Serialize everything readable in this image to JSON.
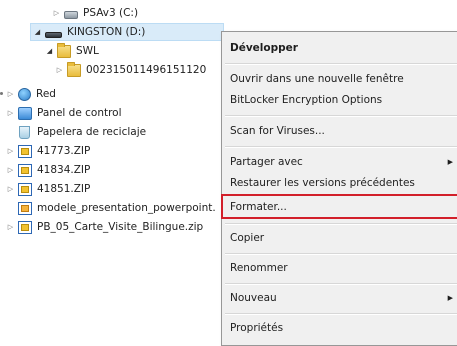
{
  "tree": {
    "items": [
      {
        "label": "PSAv3 (C:)",
        "icon": "drive-icon"
      },
      {
        "label": "KINGSTON (D:)",
        "icon": "usb-drive-icon"
      },
      {
        "label": "SWL",
        "icon": "folder-icon"
      },
      {
        "label": "002315011496151120",
        "icon": "folder-icon"
      },
      {
        "label": "Red",
        "icon": "network-icon"
      },
      {
        "label": "Panel de control",
        "icon": "control-panel-icon"
      },
      {
        "label": "Papelera de reciclaje",
        "icon": "recycle-bin-icon"
      },
      {
        "label": "41773.ZIP",
        "icon": "zip-icon"
      },
      {
        "label": "41834.ZIP",
        "icon": "zip-icon"
      },
      {
        "label": "41851.ZIP",
        "icon": "zip-icon"
      },
      {
        "label": "modele_presentation_powerpoint.",
        "icon": "pptx-icon"
      },
      {
        "label": "PB_05_Carte_Visite_Bilingue.zip",
        "icon": "zip-icon"
      }
    ]
  },
  "context_menu": {
    "items": [
      {
        "label": "Développer",
        "bold": true
      },
      {
        "label": "Ouvrir dans une nouvelle fenêtre"
      },
      {
        "label": "BitLocker Encryption Options"
      },
      {
        "label": "Scan for Viruses..."
      },
      {
        "label": "Partager avec",
        "submenu": true
      },
      {
        "label": "Restaurer les versions précédentes"
      },
      {
        "label": "Formater...",
        "highlighted": true
      },
      {
        "label": "Copier"
      },
      {
        "label": "Renommer"
      },
      {
        "label": "Nouveau",
        "submenu": true
      },
      {
        "label": "Propriétés"
      }
    ]
  },
  "colors": {
    "highlight_border": "#d21f2a",
    "selection_background": "#d9ebf9",
    "menu_background": "#f0f0f0"
  }
}
